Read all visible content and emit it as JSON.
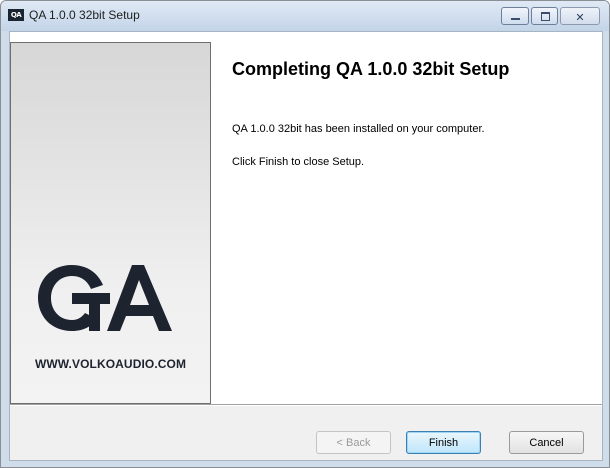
{
  "window": {
    "title": "QA 1.0.0 32bit Setup",
    "icon": "qa-app-icon"
  },
  "side_panel": {
    "logo_text": "QA",
    "url": "WWW.VOLKOAUDIO.COM"
  },
  "main": {
    "heading": "Completing QA 1.0.0 32bit Setup",
    "message_installed": "QA 1.0.0 32bit has been installed on your computer.",
    "message_finish": "Click Finish to close Setup."
  },
  "buttons": {
    "back": "< Back",
    "finish": "Finish",
    "cancel": "Cancel"
  },
  "colors": {
    "finish_border": "#3c7fb1",
    "logo": "#1d2430"
  }
}
